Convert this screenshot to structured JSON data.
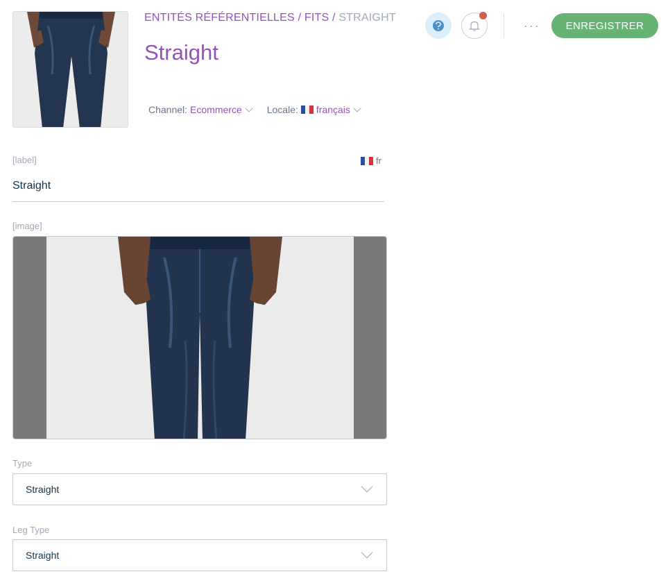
{
  "breadcrumb": {
    "items": [
      "Entités référentielles",
      "Fits"
    ],
    "separator": "/",
    "current": "Straight"
  },
  "page_title": "Straight",
  "context": {
    "channel_label": "Channel:",
    "channel_value": "Ecommerce",
    "locale_label": "Locale:",
    "locale_value": "français"
  },
  "header_actions": {
    "more": "···",
    "save_label": "Enregistrer"
  },
  "fields": {
    "label": {
      "label": "[label]",
      "locale": "fr",
      "value": "Straight"
    },
    "image": {
      "label": "[image]"
    },
    "type": {
      "label": "Type",
      "value": "Straight"
    },
    "leg_type": {
      "label": "Leg Type",
      "value": "Straight"
    }
  },
  "colors": {
    "brand_purple": "#9452ba",
    "save_green": "#67b373",
    "notification_red": "#d4604b",
    "help_blue": "#dbeef9"
  }
}
